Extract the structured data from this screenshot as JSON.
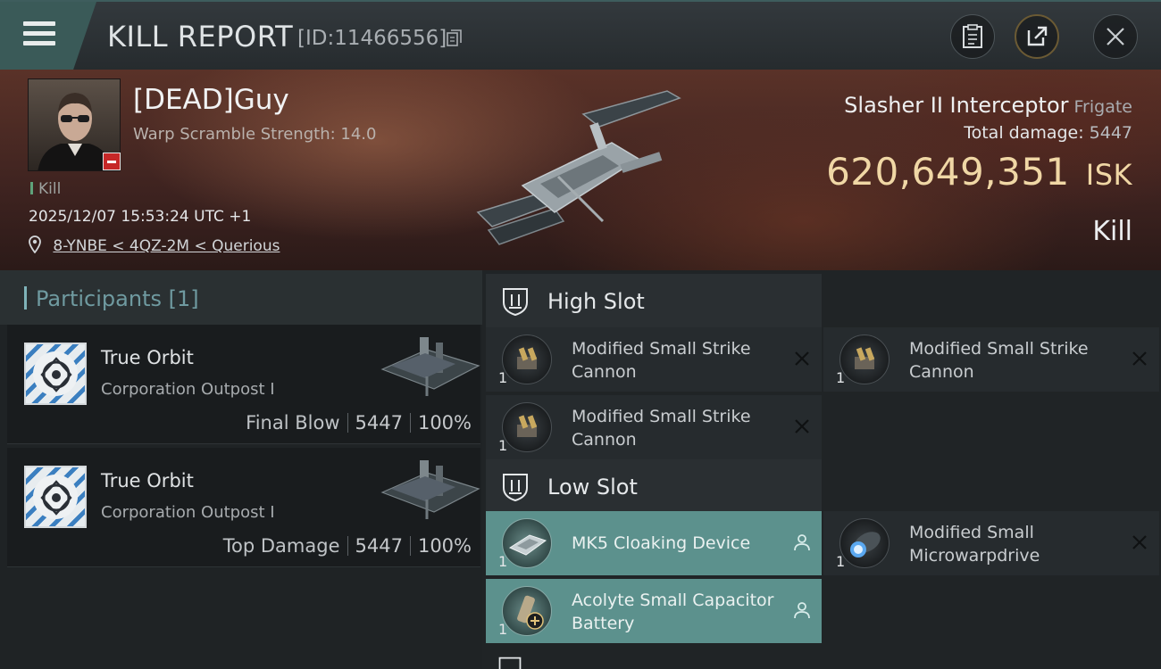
{
  "header": {
    "title": "KILL REPORT",
    "report_id": "[ID:11466556]"
  },
  "victim": {
    "name": "[DEAD]Guy",
    "subtitle": "Warp Scramble Strength: 14.0",
    "kill_label": "Kill",
    "timestamp": "2025/12/07 15:53:24 UTC +1",
    "location": "8-YNBE < 4QZ-2M < Querious",
    "ship_name": "Slasher II Interceptor",
    "ship_class": "Frigate",
    "total_damage_label": "Total damage:",
    "total_damage": "5447",
    "isk_value": "620,649,351",
    "isk_unit": "ISK",
    "result": "Kill"
  },
  "participants": {
    "label": "Participants",
    "count": "[1]",
    "items": [
      {
        "name": "True Orbit",
        "corp": "Corporation Outpost I",
        "role": "Final Blow",
        "damage": "5447",
        "percent": "100%"
      },
      {
        "name": "True Orbit",
        "corp": "Corporation Outpost I",
        "role": "Top Damage",
        "damage": "5447",
        "percent": "100%"
      }
    ]
  },
  "slots": {
    "high": {
      "label": "High Slot",
      "items": [
        {
          "name": "Modified Small Strike Cannon",
          "qty": "1"
        },
        {
          "name": "Modified Small Strike Cannon",
          "qty": "1"
        },
        {
          "name": "Modified Small Strike Cannon",
          "qty": "1"
        }
      ]
    },
    "low": {
      "label": "Low Slot",
      "items": [
        {
          "name": "MK5 Cloaking Device",
          "qty": "1"
        },
        {
          "name": "Modified Small Microwarpdrive",
          "qty": "1"
        },
        {
          "name": "Acolyte Small Capacitor Battery",
          "qty": "1"
        }
      ]
    }
  },
  "colors": {
    "accent_teal": "#5c918d",
    "isk_gold": "#f0d7a5",
    "header_tab": "#3a5a58",
    "dead_badge": "#c62828"
  }
}
